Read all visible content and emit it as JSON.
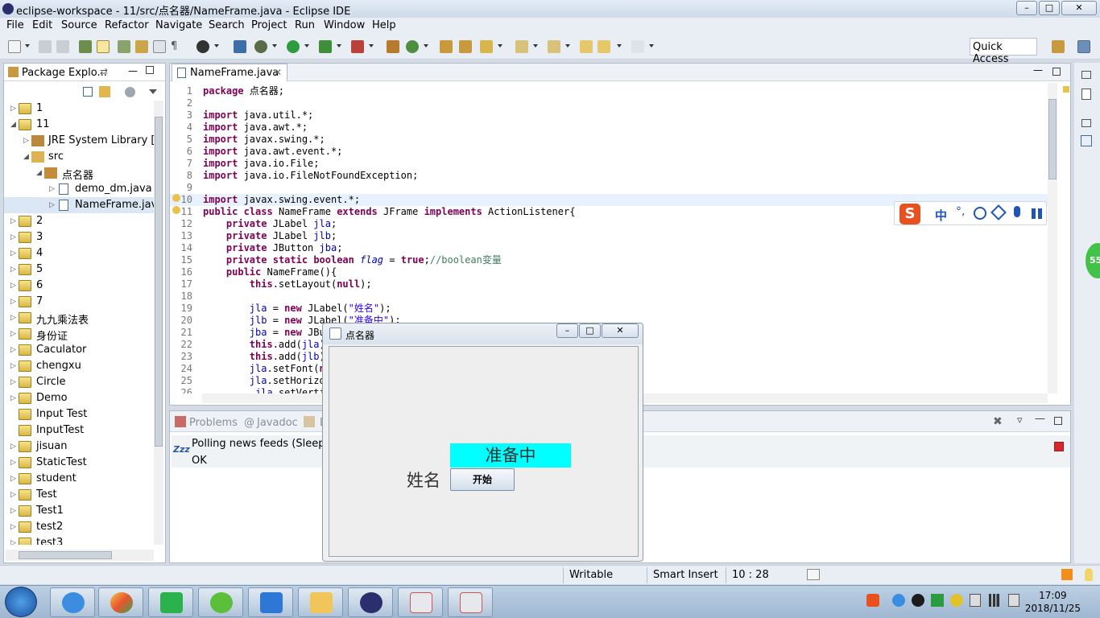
{
  "window": {
    "title": "eclipse-workspace - 11/src/点名器/NameFrame.java - Eclipse IDE"
  },
  "menu": [
    "File",
    "Edit",
    "Source",
    "Refactor",
    "Navigate",
    "Search",
    "Project",
    "Run",
    "Window",
    "Help"
  ],
  "quick_access": "Quick Access",
  "package_explorer": {
    "title": "Package Explo...",
    "items": [
      {
        "label": "1"
      },
      {
        "label": "11"
      },
      {
        "label": "JRE System Library [Ja"
      },
      {
        "label": "src"
      },
      {
        "label": "点名器"
      },
      {
        "label": "demo_dm.java"
      },
      {
        "label": "NameFrame.java"
      },
      {
        "label": "2"
      },
      {
        "label": "3"
      },
      {
        "label": "4"
      },
      {
        "label": "5"
      },
      {
        "label": "6"
      },
      {
        "label": "7"
      },
      {
        "label": "九九乘法表"
      },
      {
        "label": "身份证"
      },
      {
        "label": "Caculator"
      },
      {
        "label": "chengxu"
      },
      {
        "label": "Circle"
      },
      {
        "label": "Demo"
      },
      {
        "label": "Input Test"
      },
      {
        "label": "InputTest"
      },
      {
        "label": "jisuan"
      },
      {
        "label": "StaticTest"
      },
      {
        "label": "student"
      },
      {
        "label": "Test"
      },
      {
        "label": "Test1"
      },
      {
        "label": "test2"
      },
      {
        "label": "test3"
      }
    ]
  },
  "editor": {
    "tab": "NameFrame.java",
    "code": {
      "l1": "1",
      "l2": "2",
      "l3": "3",
      "l4": "4",
      "l5": "5",
      "l6": "6",
      "l7": "7",
      "l8": "8",
      "l9": "9",
      "l10": "10",
      "l11": "11",
      "l12": "12",
      "l13": "13",
      "l14": "14",
      "l15": "15",
      "l16": "16",
      "l17": "17",
      "l18": "18",
      "l19": "19",
      "l20": "20",
      "l21": "21",
      "l22": "22",
      "l23": "23",
      "l24": "24",
      "l25": "25",
      "l26": "26",
      "kw_package": "package",
      "pkg_name": " 点名器;",
      "kw_import": "import",
      "imp4": " java.util.*;",
      "imp5": " java.awt.*;",
      "imp6": " javax.swing.*;",
      "imp7": " java.awt.event.*;",
      "imp8": " java.io.File;",
      "imp9": " java.io.FileNotFoundException;",
      "imp11": " javax.swing.event.*;",
      "kw_public": "public",
      "kw_class": "class",
      "kw_extends": "extends",
      "kw_implements": "implements",
      "kw_private": "private",
      "kw_static": "static",
      "kw_boolean": "boolean",
      "kw_true": "true",
      "kw_this": "this",
      "kw_new": "new",
      "kw_null": "null",
      "cls_name": " NameFrame ",
      "cls_super": " JFrame ",
      "cls_iface": " ActionListener{",
      "t_jlabel": " JLabel ",
      "t_jbutton": " JButton ",
      "f_jla": "jla",
      "f_jlb": "jlb",
      "f_jba": "jba",
      "f_flag": "flag",
      "semi": ";",
      "assign": " = ",
      "cm_bool": "//boolean变量",
      "ctor": " NameFrame(){",
      "setlayout": ".setLayout(",
      "close_stmt": ");",
      "jlabel_open": " JLabel(",
      "s_xingming": "\"姓名\"",
      "s_zhunbeizhong": "\"准备中\"",
      "jbu_partial": " JBu",
      "add_open": ".add(",
      "add_close": ")",
      "setfont": ".setFont(",
      "ne_partial": "ne",
      "sethoriz": ".setHorizo",
      "setverti": ".setVerti"
    }
  },
  "problems": {
    "tabs": [
      "Problems",
      "Javadoc",
      "D"
    ],
    "zzz": "Zzz",
    "line1": "Polling news feeds (Sleeping",
    "line2": "OK"
  },
  "status": {
    "writable": "Writable",
    "insert": "Smart Insert",
    "position": "10 : 28"
  },
  "app_frame": {
    "title": "点名器",
    "name_label": "姓名",
    "status_label": "准备中",
    "start_button": "开始",
    "label_bg": "#00ffff"
  },
  "ime": {
    "zh": "中"
  },
  "trim": {
    "badge": "55"
  },
  "taskbar": {
    "time": "17:09",
    "date": "2018/11/25"
  }
}
